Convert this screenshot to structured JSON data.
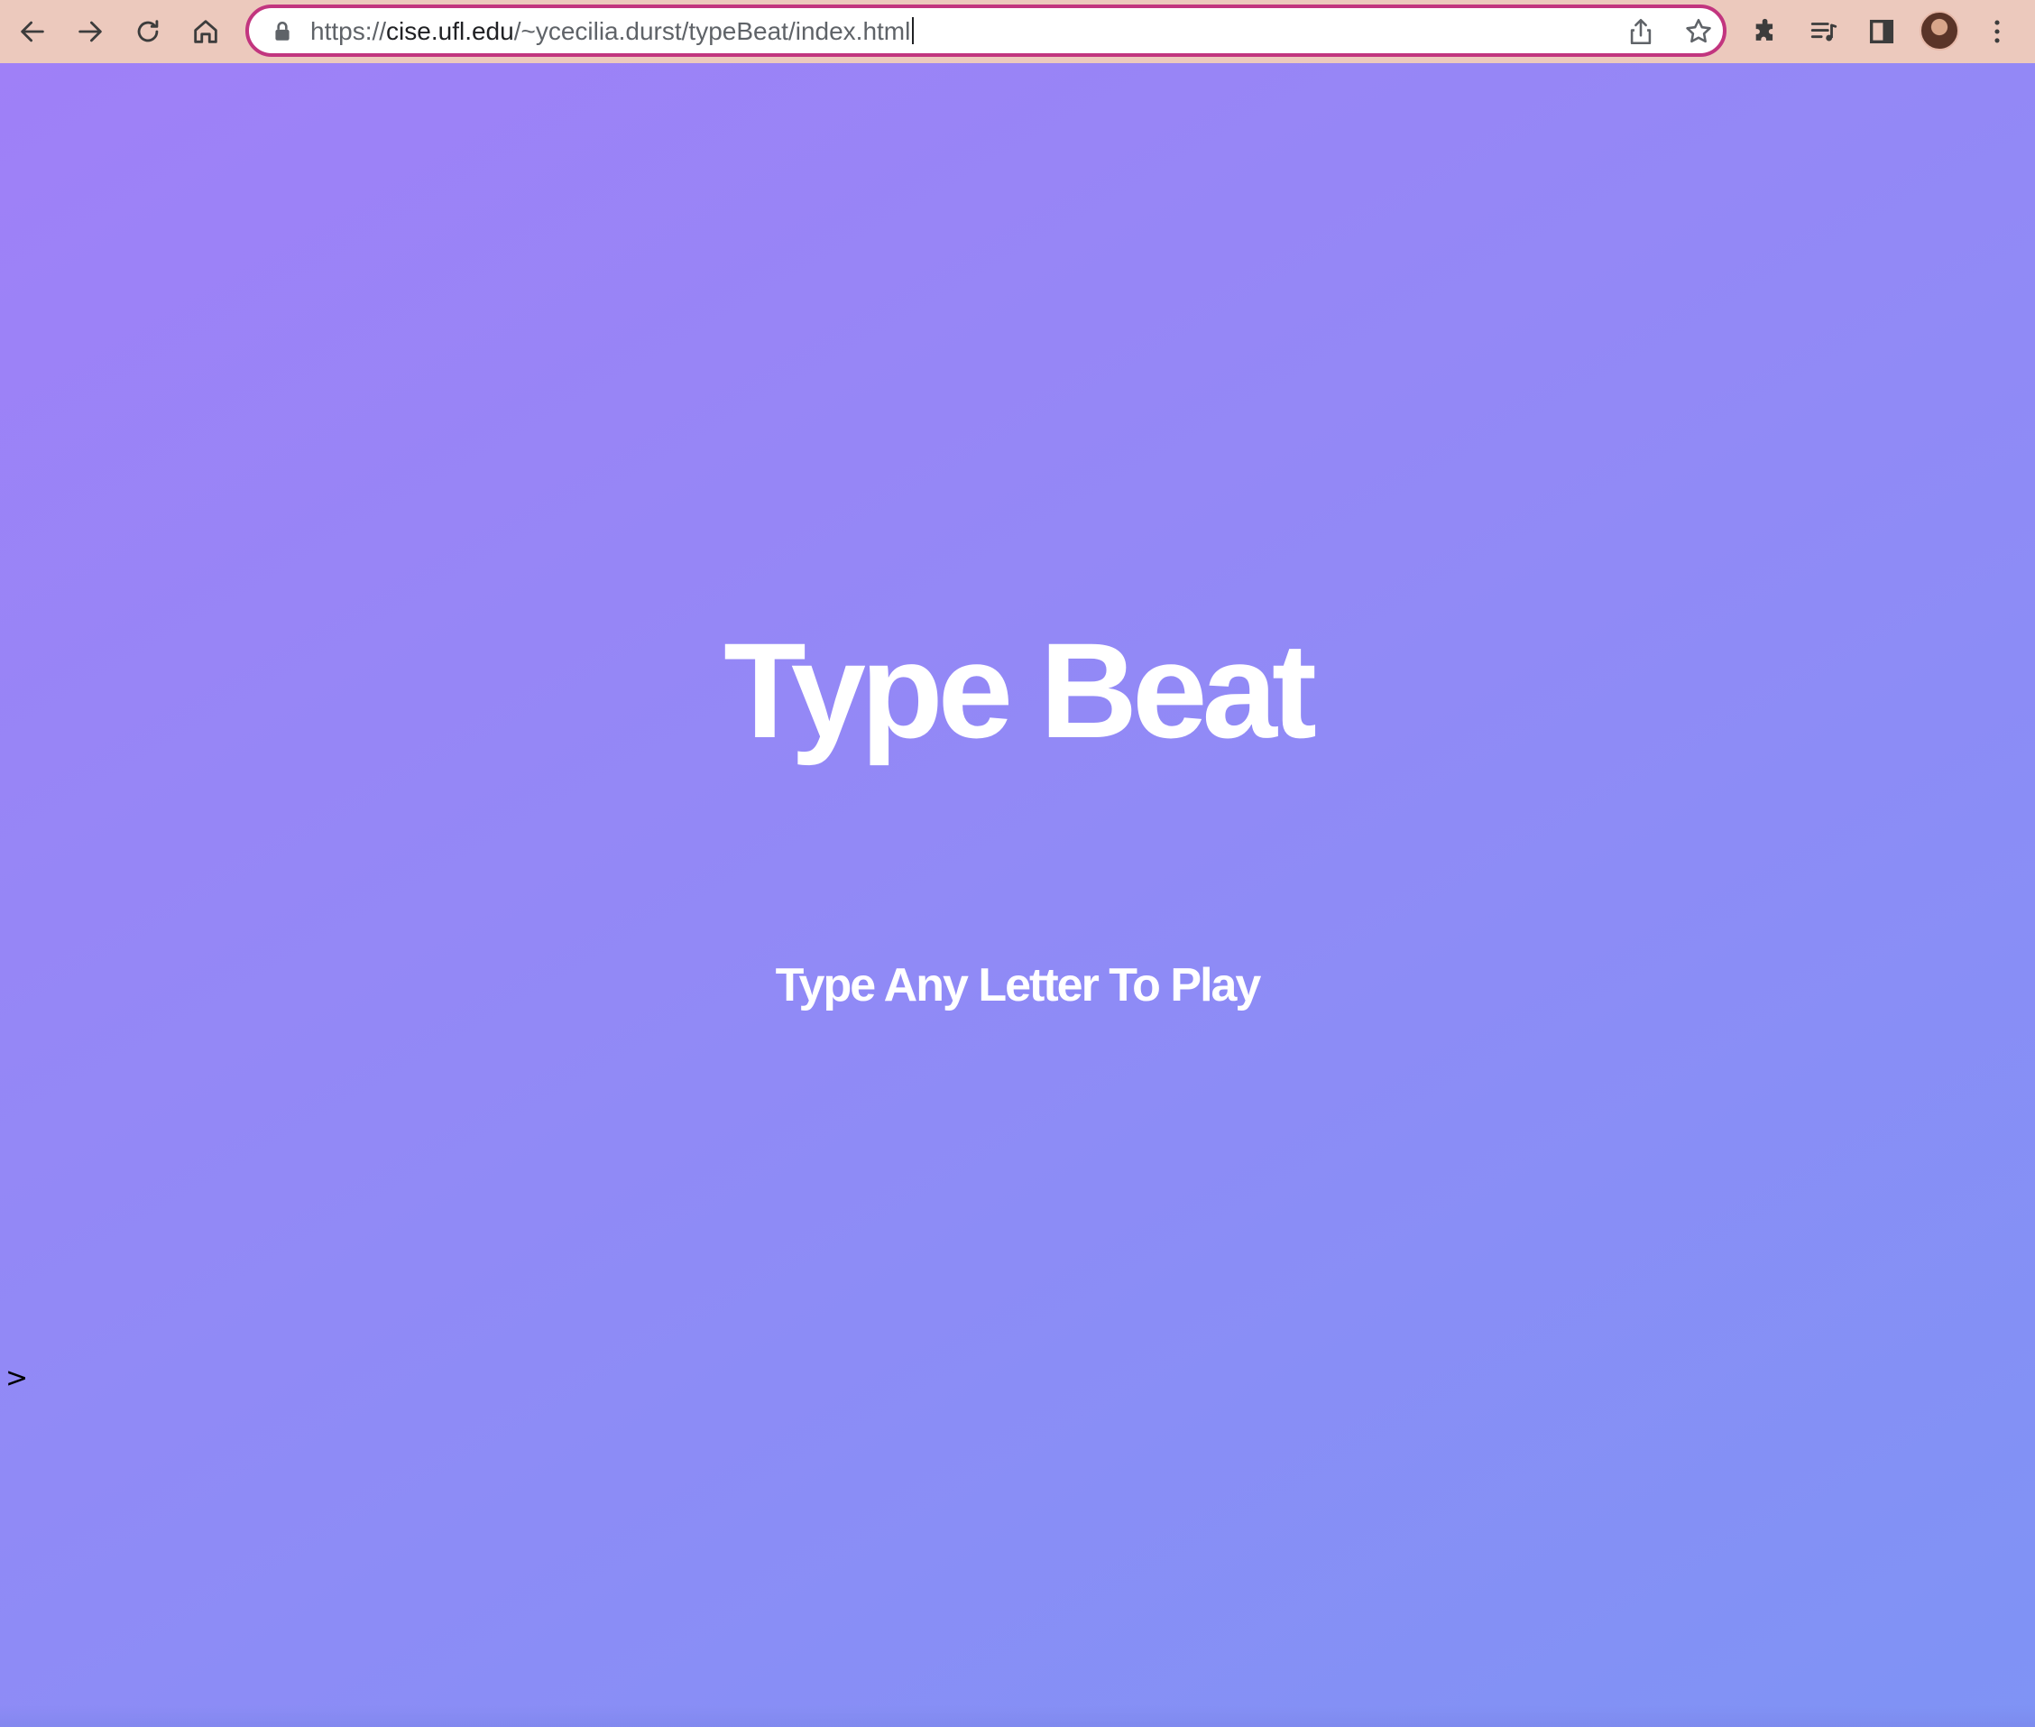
{
  "browser": {
    "url_scheme": "https://",
    "url_host": "cise.ufl.edu",
    "url_path": "/~ycecilia.durst/typeBeat/index.html"
  },
  "page": {
    "title": "Type Beat",
    "subtitle": "Type Any Letter To Play",
    "prompt": ">"
  },
  "colors": {
    "toolbar": "#ecc9bd",
    "omnibox_border": "#c2357f",
    "gradient_start": "#9f80f7",
    "gradient_end": "#7f93f5",
    "text": "#ffffff"
  },
  "icons": [
    "back-arrow-icon",
    "forward-arrow-icon",
    "reload-icon",
    "home-icon",
    "lock-icon",
    "share-icon",
    "bookmark-star-icon",
    "extensions-puzzle-icon",
    "media-control-icon",
    "side-panel-icon",
    "kebab-menu-icon"
  ]
}
